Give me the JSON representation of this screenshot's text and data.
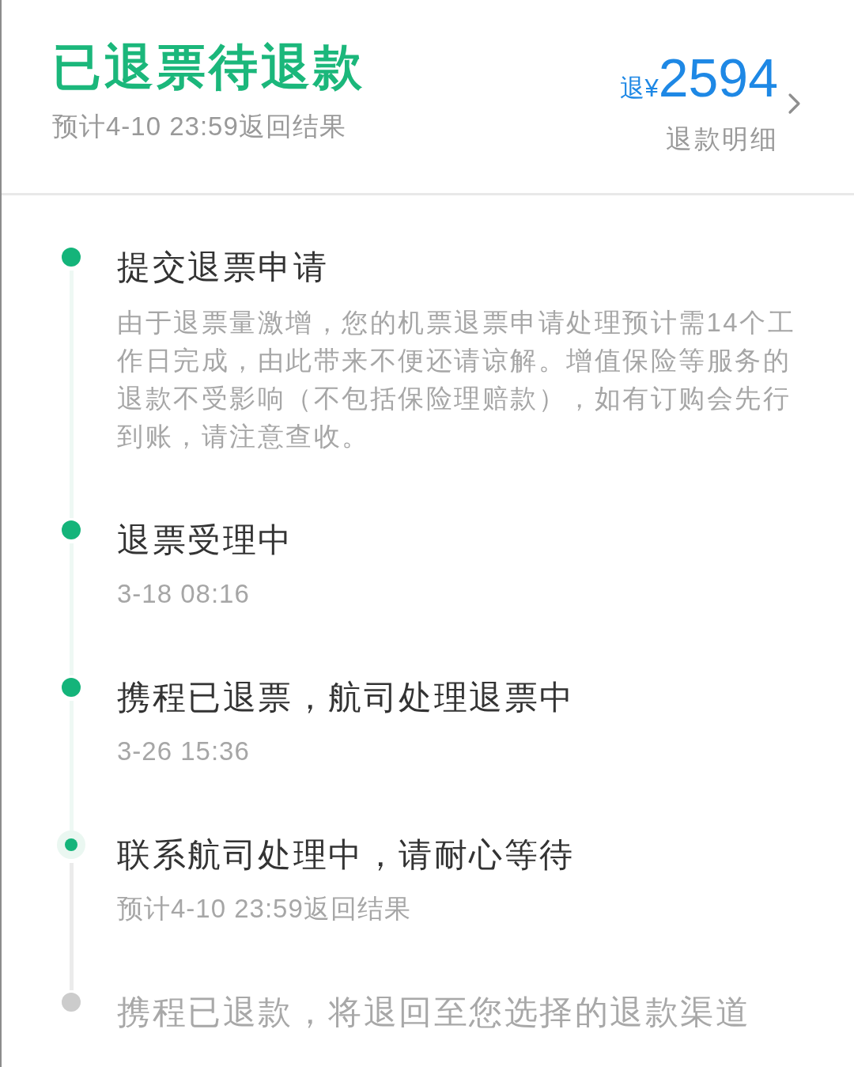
{
  "header": {
    "title": "已退票待退款",
    "subtitle": "预计4-10 23:59返回结果",
    "refund": {
      "prefix": "退¥",
      "amount": "2594",
      "link": "退款明细"
    }
  },
  "timeline": [
    {
      "title": "提交退票申请",
      "detail": "由于退票量激增，您的机票退票申请处理预计需14个工作日完成，由此带来不便还请谅解。增值保险等服务的退款不受影响（不包括保险理赔款），如有订购会先行到账，请注意查收。",
      "kind": "note",
      "completed": true,
      "current": false
    },
    {
      "title": "退票受理中",
      "detail": "3-18 08:16",
      "kind": "time",
      "completed": true,
      "current": false
    },
    {
      "title": "携程已退票，航司处理退票中",
      "detail": "3-26 15:36",
      "kind": "time",
      "completed": true,
      "current": false
    },
    {
      "title": "联系航司处理中，请耐心等待",
      "detail": "预计4-10 23:59返回结果",
      "kind": "time",
      "completed": false,
      "current": true
    },
    {
      "title": "携程已退款，将退回至您选择的退款渠道",
      "completed": false,
      "current": false
    }
  ]
}
